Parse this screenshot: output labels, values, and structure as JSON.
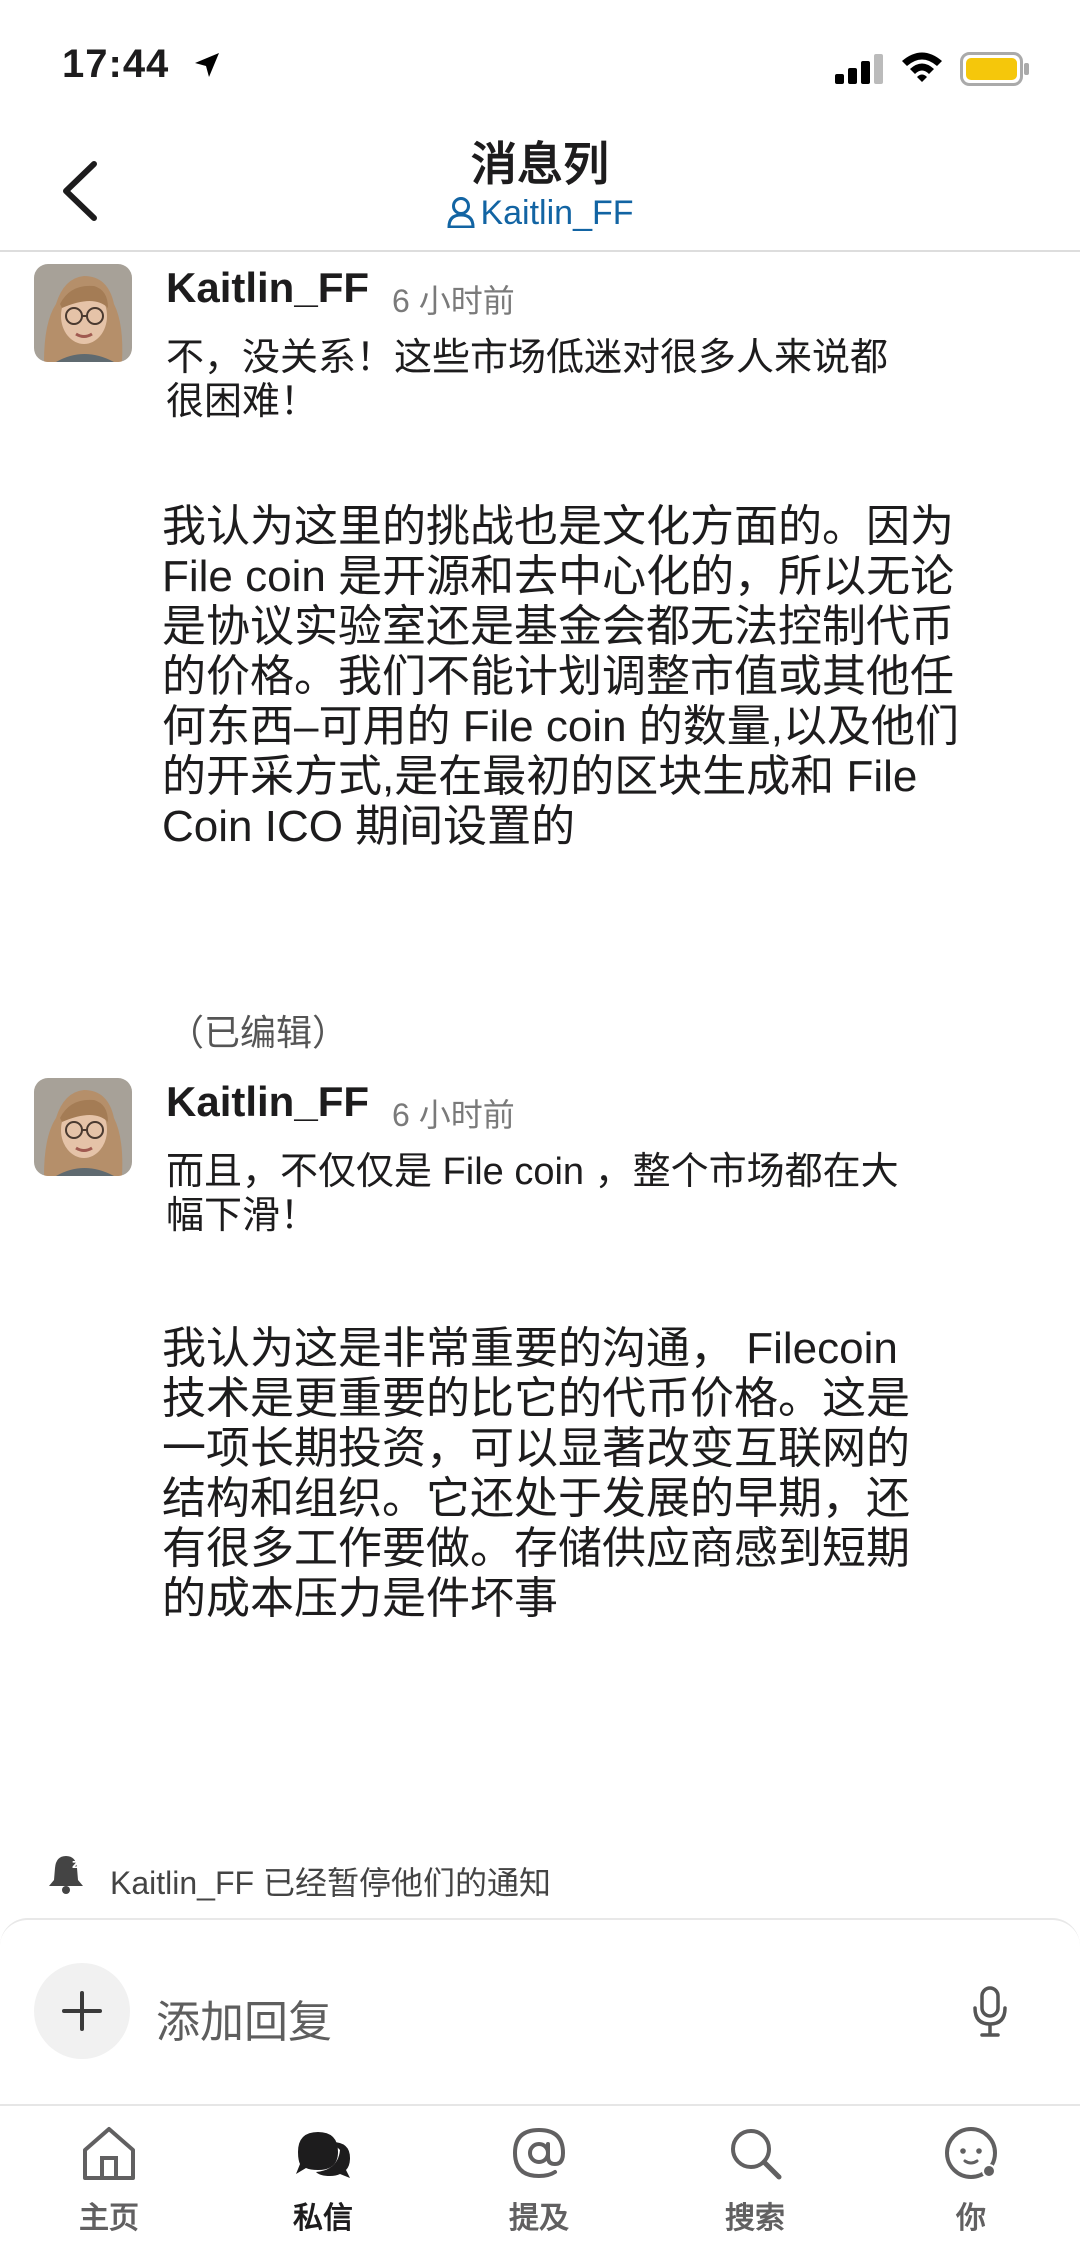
{
  "status_bar": {
    "time": "17:44"
  },
  "header": {
    "title": "消息列",
    "subtitle": "Kaitlin_FF"
  },
  "messages": [
    {
      "author": "Kaitlin_FF",
      "time": "6 小时前",
      "text_1": "不，没关系！这些市场低迷对很多人来说都\n很困难！",
      "text_2": "我认为这里的挑战也是文化方面的。因为\nFile coin 是开源和去中心化的，所以无论\n是协议实验室还是基金会都无法控制代币\n的价格。我们不能计划调整市值或其他任\n何东西–可用的 File coin 的数量,以及他们\n的开采方式,是在最初的区块生成和 File\nCoin ICO 期间设置的",
      "edited": "（已编辑）"
    },
    {
      "author": "Kaitlin_FF",
      "time": "6 小时前",
      "text_1": "而且，不仅仅是 File coin ，整个市场都在大\n幅下滑！",
      "text_2": "我认为这是非常重要的沟通， Filecoin\n技术是更重要的比它的代币价格。这是\n一项长期投资，可以显著改变互联网的\n结构和组织。它还处于发展的早期，还\n有很多工作要做。存储供应商感到短期\n的成本压力是件坏事"
    }
  ],
  "notification": {
    "text": "Kaitlin_FF 已经暂停他们的通知"
  },
  "reply": {
    "placeholder": "添加回复"
  },
  "tabs": [
    {
      "label": "主页",
      "icon": "home-icon"
    },
    {
      "label": "私信",
      "icon": "dm-icon",
      "active": true
    },
    {
      "label": "提及",
      "icon": "mention-icon"
    },
    {
      "label": "搜索",
      "icon": "search-icon"
    },
    {
      "label": "你",
      "icon": "profile-icon"
    }
  ]
}
